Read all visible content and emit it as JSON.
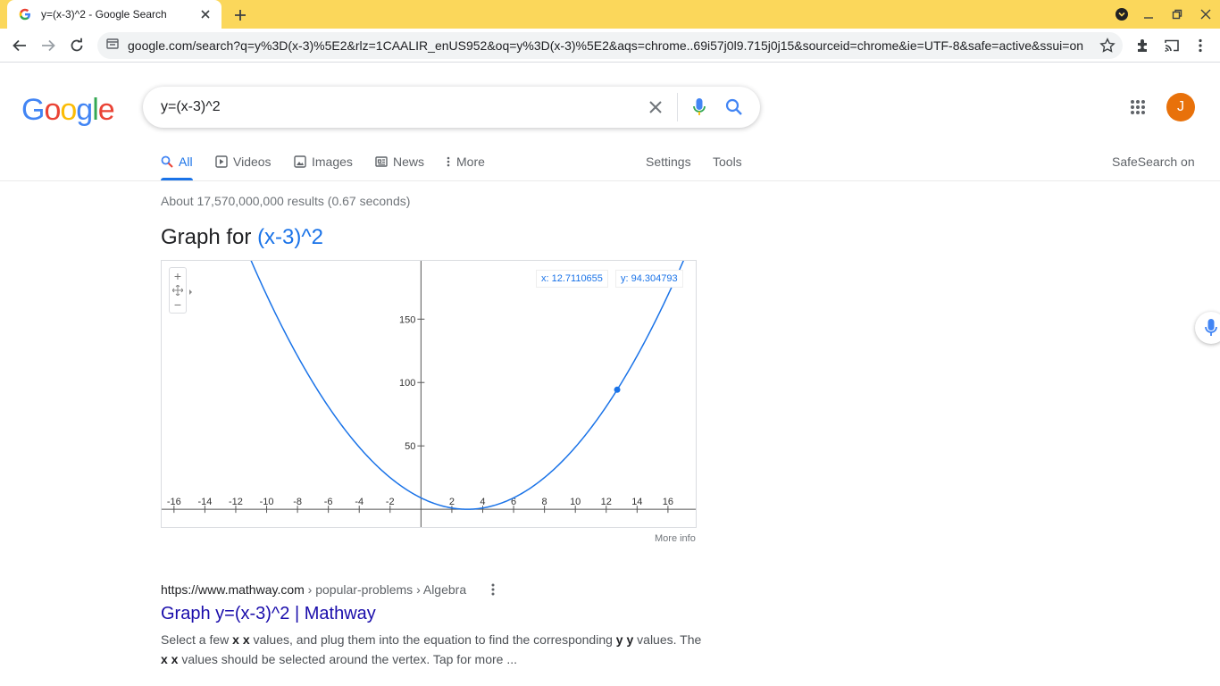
{
  "browser": {
    "tab_title": "y=(x-3)^2 - Google Search",
    "url": "google.com/search?q=y%3D(x-3)%5E2&rlz=1CAALIR_enUS952&oq=y%3D(x-3)%5E2&aqs=chrome..69i57j0l9.715j0j15&sourceid=chrome&ie=UTF-8&safe=active&ssui=on",
    "tabstrip_color": "#fbd75b"
  },
  "header": {
    "logo": [
      "G",
      "o",
      "o",
      "g",
      "l",
      "e"
    ],
    "search_query": "y=(x-3)^2",
    "avatar_letter": "J"
  },
  "tabs": [
    {
      "label": "All",
      "icon": "search-icon"
    },
    {
      "label": "Videos",
      "icon": "play-icon"
    },
    {
      "label": "Images",
      "icon": "image-icon"
    },
    {
      "label": "News",
      "icon": "newspaper-icon"
    },
    {
      "label": "More",
      "icon": "more-vert-icon"
    }
  ],
  "tools": {
    "settings": "Settings",
    "tools": "Tools",
    "safesearch": "SafeSearch on"
  },
  "results": {
    "stats": "About 17,570,000,000 results (0.67 seconds)",
    "graph_title_prefix": "Graph for",
    "graph_title_fn": "(x-3)^2",
    "more_info": "More info"
  },
  "chart_data": {
    "type": "line",
    "function": "(x-3)^2",
    "xlim": [
      -16.8,
      17.8
    ],
    "ylim": [
      -14,
      196
    ],
    "x_ticks": [
      -16,
      -14,
      -12,
      -10,
      -8,
      -6,
      -4,
      -2,
      2,
      4,
      6,
      8,
      10,
      12,
      14,
      16
    ],
    "y_ticks": [
      50,
      100,
      150
    ],
    "hover_point": {
      "x": 12.7110655,
      "y": 94.304793
    },
    "readout_x": "x: 12.7110655",
    "readout_y": "y: 94.304793",
    "line_color": "#1a73e8"
  },
  "result": {
    "cite_url": "https://www.mathway.com",
    "cite_path": " › popular-problems › Algebra",
    "title": "Graph y=(x-3)^2 | Mathway",
    "snippet_1": "Select a few ",
    "snippet_b1": "x x",
    "snippet_2": " values, and plug them into the equation to find the corresponding ",
    "snippet_b2": "y y",
    "snippet_3": " values. The ",
    "snippet_b3": "x x",
    "snippet_4": " values should be selected around the vertex. Tap for more ..."
  }
}
